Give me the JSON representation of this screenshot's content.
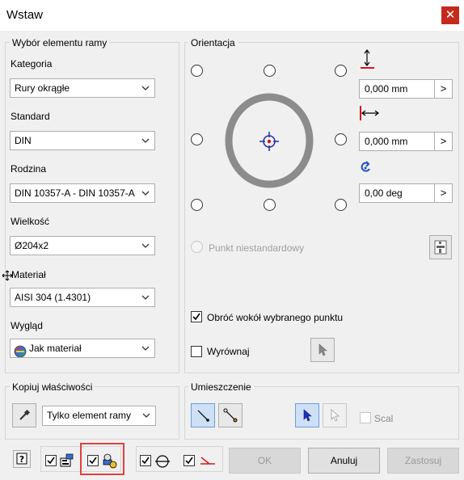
{
  "window": {
    "title": "Wstaw",
    "close_glyph": "✕"
  },
  "frame_selection": {
    "legend": "Wybór elementu ramy",
    "category_label": "Kategoria",
    "category_value": "Rury okrągłe",
    "standard_label": "Standard",
    "standard_value": "DIN",
    "family_label": "Rodzina",
    "family_value": "DIN 10357-A - DIN 10357-A",
    "size_label": "Wielkość",
    "size_value": "Ø204x2",
    "material_label": "Materiał",
    "material_value": "AISI 304 (1.4301)",
    "appearance_label": "Wygląd",
    "appearance_value": "Jak materiał"
  },
  "orientation": {
    "legend": "Orientacja",
    "vertical_offset": "0,000 mm",
    "horizontal_offset": "0,000 mm",
    "rotation": "0,00 deg",
    "arrow_glyph": ">",
    "custom_point_label": "Punkt niestandardowy",
    "rotate_about_point_label": "Obróć wokół wybranego punktu",
    "rotate_about_point_checked": true,
    "align_label": "Wyrównaj",
    "align_checked": false
  },
  "copy_props": {
    "legend": "Kopiuj właściwości",
    "mode_value": "Tylko element ramy"
  },
  "placement": {
    "legend": "Umieszczenie",
    "scale_label": "Scal",
    "scale_checked": false
  },
  "footer": {
    "ok_label": "OK",
    "cancel_label": "Anuluj",
    "apply_label": "Zastosuj"
  },
  "colors": {
    "accent_red": "#e04040",
    "profile_gray": "#8c8c8c",
    "target_blue": "#1e2fb4",
    "target_red": "#d01818",
    "title_close": "#c42b1c"
  },
  "icons": {
    "chevron": "chevron-down-icon",
    "check": "checkmark-icon",
    "cursor": "cursor-arrow-icon",
    "help": "help-icon",
    "eyedropper": "eyedropper-icon"
  }
}
